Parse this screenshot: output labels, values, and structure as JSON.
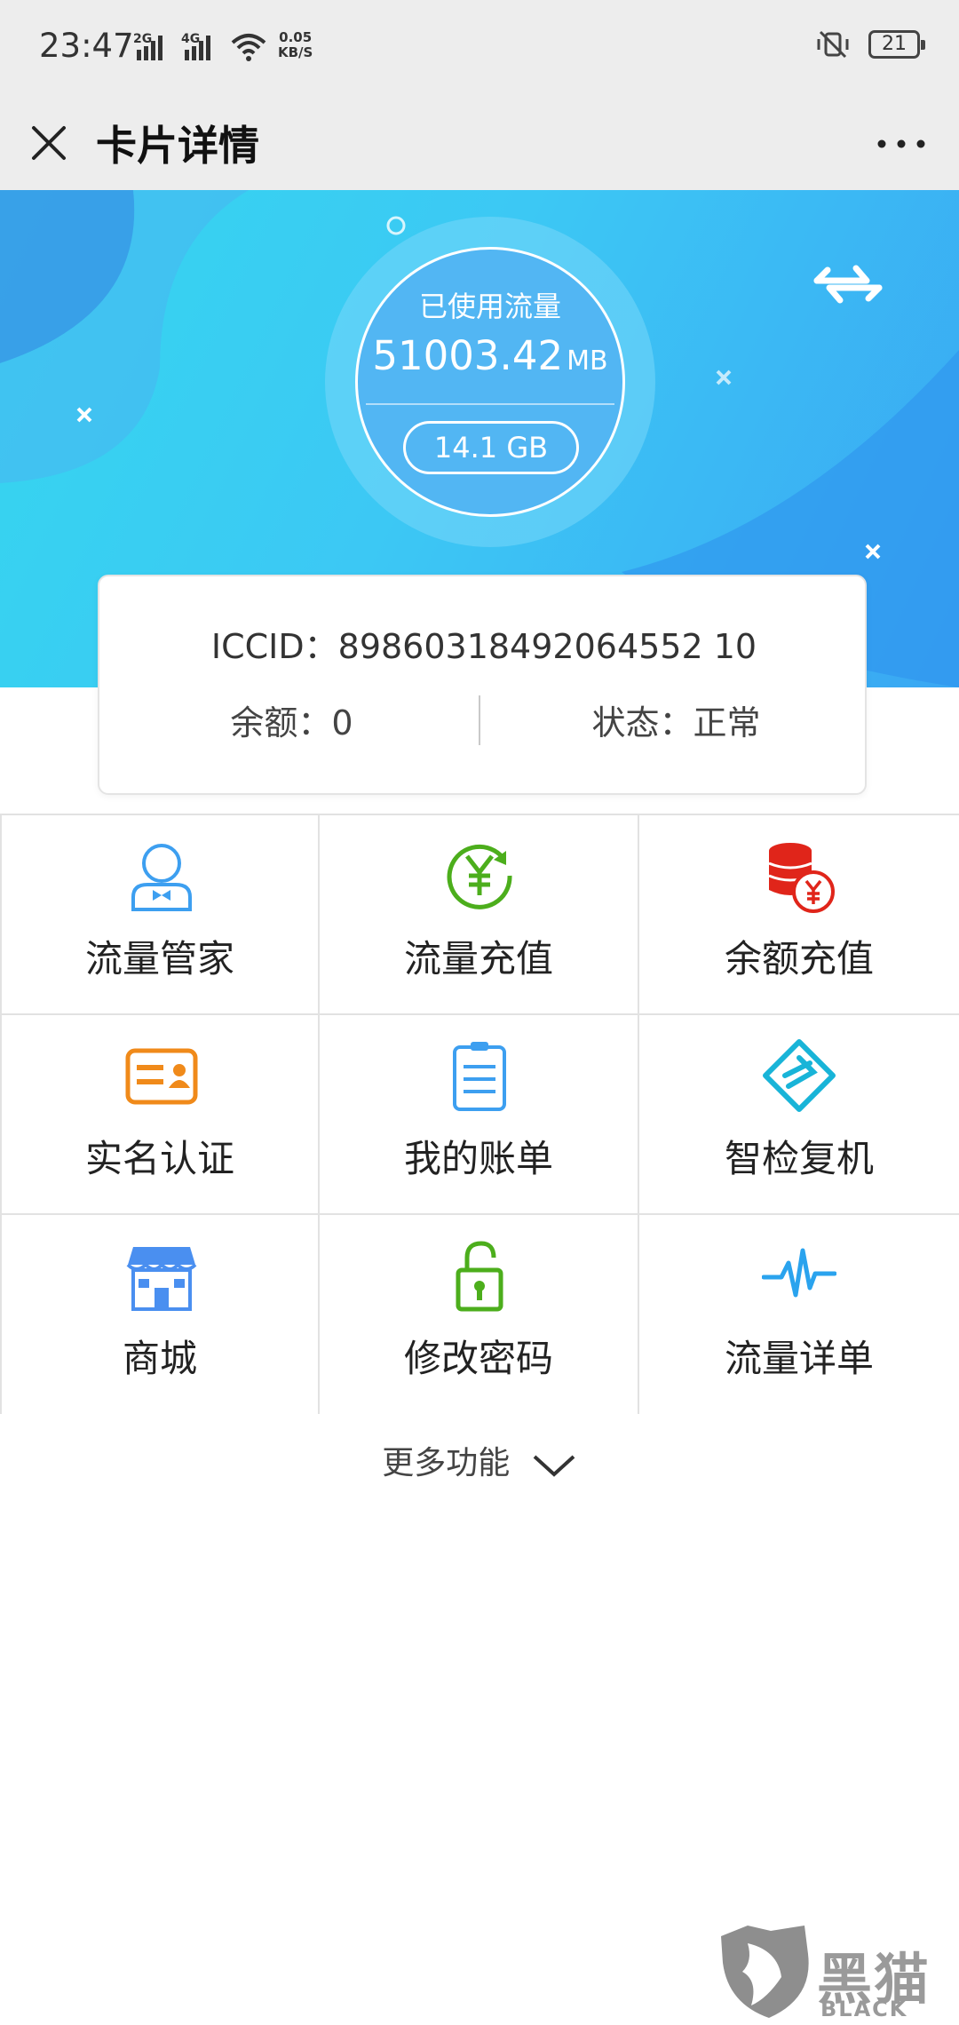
{
  "status_bar": {
    "time": "23:47",
    "net_2g": "2G",
    "net_4g": "4G",
    "net_speed_value": "0.05",
    "net_speed_unit": "KB/S",
    "battery": "21"
  },
  "header": {
    "title": "卡片详情"
  },
  "usage": {
    "label": "已使用流量",
    "value": "51003.42",
    "unit": "MB",
    "gb_value": "14.1 GB"
  },
  "card_info": {
    "iccid": "ICCID：89860318492064552 10",
    "balance": "余额：0",
    "status": "状态：正常"
  },
  "features": [
    {
      "label": "流量管家",
      "icon": "user-tie-icon",
      "color": "#3d9ff0"
    },
    {
      "label": "流量充值",
      "icon": "yuan-circle-icon",
      "color": "#4cae1c"
    },
    {
      "label": "余额充值",
      "icon": "coins-icon",
      "color": "#e0251a"
    },
    {
      "label": "实名认证",
      "icon": "id-card-icon",
      "color": "#f08a1a"
    },
    {
      "label": "我的账单",
      "icon": "clipboard-icon",
      "color": "#3d9ff0"
    },
    {
      "label": "智检复机",
      "icon": "diamond-icon",
      "color": "#18b4d8"
    },
    {
      "label": "商城",
      "icon": "store-icon",
      "color": "#4a8ff0"
    },
    {
      "label": "修改密码",
      "icon": "unlock-icon",
      "color": "#4cae1c"
    },
    {
      "label": "流量详单",
      "icon": "pulse-icon",
      "color": "#2aa3ee"
    }
  ],
  "more": {
    "label": "更多功能"
  },
  "watermark": {
    "title": "黑猫",
    "subtitle": "BLACK CAT"
  },
  "colors": {
    "header_bg": "#ededed",
    "hero_start": "#35d6ef",
    "hero_end": "#3aa7f3"
  }
}
